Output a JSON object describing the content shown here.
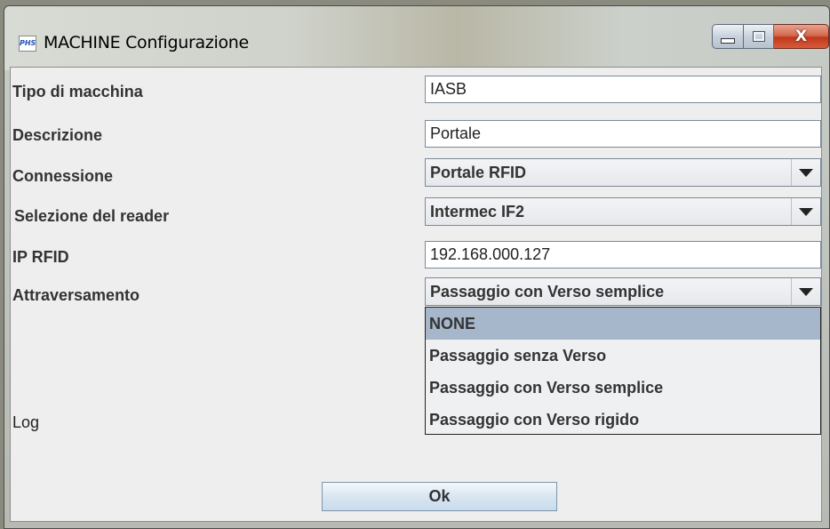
{
  "window": {
    "title": "MACHINE Configurazione",
    "icon_text": "PHS",
    "controls": {
      "minimize": "minimize-icon",
      "maximize": "maximize-icon",
      "close": "X"
    }
  },
  "form": {
    "tipo": {
      "label": "Tipo di macchina",
      "value": "IASB"
    },
    "descrizione": {
      "label": "Descrizione",
      "value": "Portale"
    },
    "connessione": {
      "label": "Connessione",
      "value": "Portale  RFID"
    },
    "reader": {
      "label": "Selezione del reader",
      "value": "Intermec  IF2"
    },
    "ip": {
      "label": "IP RFID",
      "value": "192.168.000.127"
    },
    "attraversamento": {
      "label": "Attraversamento",
      "value": "Passaggio con Verso semplice"
    },
    "log": {
      "label": "Log"
    }
  },
  "dropdown": {
    "selected_index": 0,
    "options": [
      "NONE",
      "Passaggio senza Verso",
      "Passaggio con Verso semplice",
      "Passaggio con Verso rigido"
    ]
  },
  "buttons": {
    "ok": "Ok"
  },
  "colors": {
    "selection": "#a6b6cb",
    "close_button": "#c0391c",
    "panel": "#eeeeee"
  }
}
